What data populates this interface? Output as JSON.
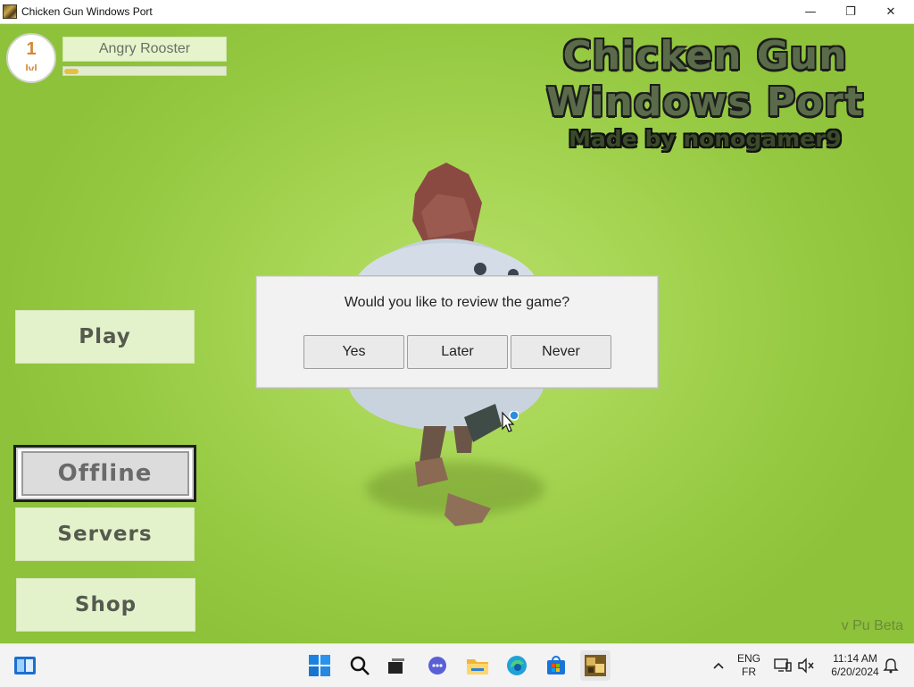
{
  "window": {
    "title": "Chicken Gun Windows Port",
    "controls": {
      "minimize": "—",
      "maximize": "❐",
      "close": "✕"
    }
  },
  "player": {
    "level": "1",
    "level_unit": "lvl",
    "name": "Angry Rooster",
    "xp_progress": 0.09
  },
  "logo": {
    "line1": "Chicken Gun",
    "line2": "Windows Port",
    "credit": "Made by nonogamer9"
  },
  "menu": {
    "play": "Play",
    "offline": "Offline",
    "servers": "Servers",
    "shop": "Shop"
  },
  "version": "v Pu Beta",
  "dialog": {
    "message": "Would you like to review the game?",
    "yes": "Yes",
    "later": "Later",
    "never": "Never"
  },
  "taskbar": {
    "language_line1": "ENG",
    "language_line2": "FR",
    "time": "11:14 AM",
    "date": "6/20/2024",
    "icons": [
      "widgets-icon",
      "start-icon",
      "search-icon",
      "task-view-icon",
      "chat-icon",
      "file-explorer-icon",
      "edge-icon",
      "store-icon",
      "chicken-gun-icon"
    ]
  },
  "colors": {
    "background_green": "#9fd04b",
    "xp_fill": "#e7c042",
    "level_text": "#d08a3a"
  }
}
